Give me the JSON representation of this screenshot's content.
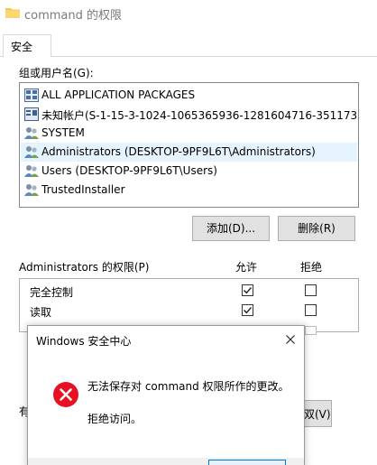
{
  "window": {
    "title": "command 的权限",
    "tabs": [
      {
        "label": "安全"
      }
    ]
  },
  "groups": {
    "label": "组或用户名(G):",
    "items": [
      {
        "label": "ALL APPLICATION PACKAGES",
        "icon": "app-packages-icon"
      },
      {
        "label": "未知帐户(S-1-15-3-1024-1065365936-1281604716-351173…",
        "icon": "unknown-account-icon"
      },
      {
        "label": "SYSTEM",
        "icon": "user-group-icon"
      },
      {
        "label": "Administrators (DESKTOP-9PF9L6T\\Administrators)",
        "icon": "user-group-icon",
        "selected": true
      },
      {
        "label": "Users (DESKTOP-9PF9L6T\\Users)",
        "icon": "user-group-icon"
      },
      {
        "label": "TrustedInstaller",
        "icon": "user-group-icon"
      }
    ],
    "add_label": "添加(D)...",
    "remove_label": "删除(R)"
  },
  "permissions": {
    "label": "Administrators 的权限(P)",
    "allow_header": "允许",
    "deny_header": "拒绝",
    "rows": [
      {
        "name": "完全控制",
        "allow": true,
        "deny": false
      },
      {
        "name": "读取",
        "allow": true,
        "deny": false
      }
    ]
  },
  "background_fragments": {
    "left_text": "有",
    "right_button": "双(V)"
  },
  "dialog": {
    "title": "Windows 安全中心",
    "message": "无法保存对 command 权限所作的更改。",
    "detail": "拒绝访问。"
  },
  "colors": {
    "selection": "#e5f3ff",
    "error_red": "#e81123",
    "button_face": "#e1e1e1",
    "focus_blue": "#0078d7"
  }
}
